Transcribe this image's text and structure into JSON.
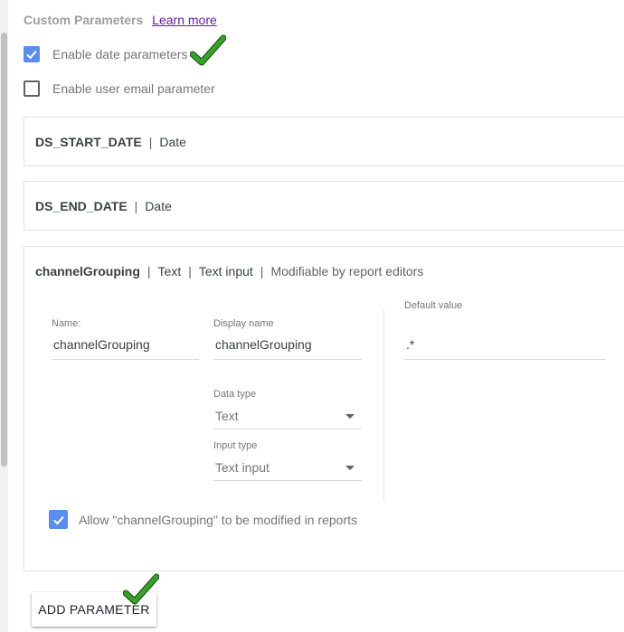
{
  "section": {
    "title": "Custom Parameters",
    "learn_more": "Learn more"
  },
  "options": {
    "date_params": {
      "label": "Enable date parameters",
      "checked": true
    },
    "email_param": {
      "label": "Enable user email parameter",
      "checked": false
    }
  },
  "params": [
    {
      "name": "DS_START_DATE",
      "type": "Date"
    },
    {
      "name": "DS_END_DATE",
      "type": "Date"
    }
  ],
  "expanded": {
    "name": "channelGrouping",
    "type": "Text",
    "input_kind": "Text input",
    "modifiable": "Modifiable by report editors",
    "fields": {
      "name_label": "Name:",
      "name_value": "channelGrouping",
      "display_label": "Display name",
      "display_value": "channelGrouping",
      "data_type_label": "Data type",
      "data_type_value": "Text",
      "input_type_label": "Input type",
      "input_type_value": "Text input",
      "default_label": "Default value",
      "default_value": ".*"
    },
    "allow_modify": {
      "label": "Allow \"channelGrouping\" to be modified in reports",
      "checked": true
    }
  },
  "add_button": "ADD PARAMETER",
  "colors": {
    "accent": "#5b8def",
    "link": "#6a1b9a",
    "annotation_check": "#3aa12b"
  },
  "icons": [
    "checkbox-checked-icon",
    "checkbox-unchecked-icon",
    "dropdown-arrow-icon",
    "green-checkmark-icon"
  ]
}
